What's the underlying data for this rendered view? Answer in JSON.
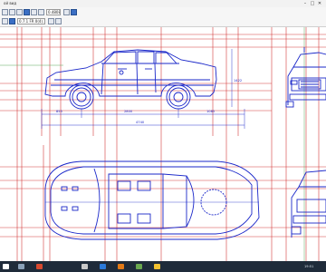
{
  "window": {
    "title": "ой вид",
    "minimize_glyph": "–",
    "maximize_glyph": "□",
    "close_glyph": "✕"
  },
  "toolbar": {
    "zoom_value": "0.4808",
    "coords_value": "0.7.1 FR 0(4).14",
    "icons": [
      "zoom-in-icon",
      "zoom-out-icon",
      "pan-icon",
      "fit-icon",
      "zoom-window-icon",
      "zoom-previous-icon",
      "refresh-icon",
      "regenerate-icon",
      "settings-icon",
      "view-icon"
    ]
  },
  "drawing": {
    "dimensions": {
      "front_overhang": "855",
      "wheelbase": "2800",
      "rear_overhang": "1085",
      "overall_length": "4740",
      "side_height": "1422"
    }
  },
  "taskbar": {
    "start_icon": "windows-start-icon",
    "pinned_icons": [
      "explorer-icon",
      "browser-icon",
      "cad-icon",
      "office-icon",
      "media-icon",
      "chrome-icon",
      "folder-icon"
    ],
    "clock": "19:51"
  },
  "colors": {
    "drawing_blue": "#1a27c9",
    "guide_red": "#d43a3a",
    "taskbar_bg": "#1f2b3a"
  }
}
